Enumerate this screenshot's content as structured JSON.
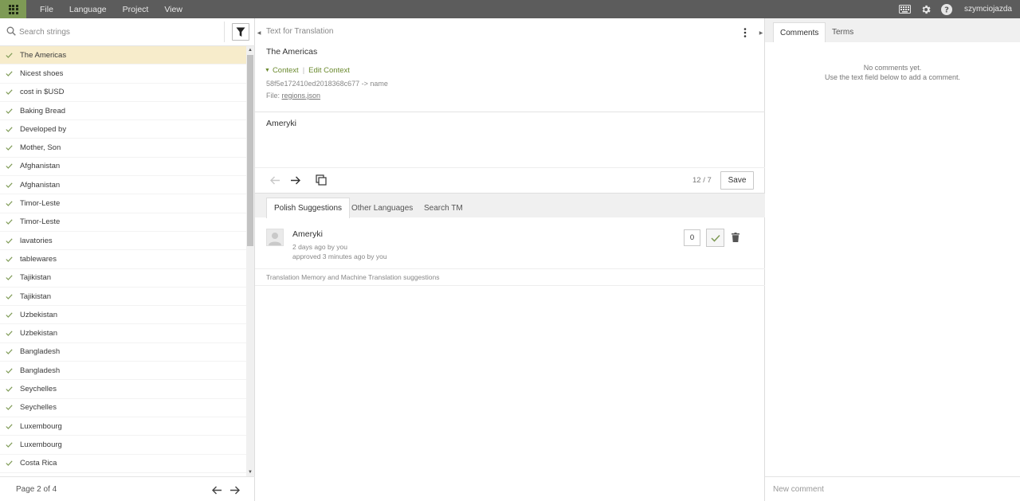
{
  "topbar": {
    "menu": [
      "File",
      "Language",
      "Project",
      "View"
    ],
    "username": "szymciojazda",
    "icons": [
      "apps-icon",
      "keyboard-icon",
      "gear-icon",
      "help-icon"
    ]
  },
  "sidebar": {
    "search_placeholder": "Search strings",
    "items": [
      "The Americas",
      "Nicest shoes",
      "cost in $USD",
      "Baking Bread",
      "Developed by",
      "Mother, Son",
      "Afghanistan",
      "Afghanistan",
      "Timor-Leste",
      "Timor-Leste",
      "lavatories",
      "tablewares",
      "Tajikistan",
      "Tajikistan",
      "Uzbekistan",
      "Uzbekistan",
      "Bangladesh",
      "Bangladesh",
      "Seychelles",
      "Seychelles",
      "Luxembourg",
      "Luxembourg",
      "Costa Rica"
    ],
    "selected_index": 0,
    "page_label": "Page 2 of 4"
  },
  "editor": {
    "source_header": "Text for Translation",
    "source_text": "The Americas",
    "context_label": "Context",
    "edit_context_label": "Edit Context",
    "key": "58f5e172410ed2018368c677 -> name",
    "file_prefix": "File:",
    "file_name": "regions.json",
    "translation": "Ameryki",
    "counter": "12 / 7",
    "save_label": "Save"
  },
  "suggestions": {
    "tabs": [
      "Polish Suggestions",
      "Other Languages",
      "Search TM"
    ],
    "active_tab": 0,
    "items": [
      {
        "text": "Ameryki",
        "meta1": "2 days ago by you",
        "meta2": "approved 3 minutes ago by you",
        "votes": "0"
      }
    ],
    "tm_label": "Translation Memory and Machine Translation suggestions"
  },
  "comments": {
    "tabs": [
      "Comments",
      "Terms"
    ],
    "active_tab": 0,
    "empty_line1": "No comments yet.",
    "empty_line2": "Use the text field below to add a comment.",
    "input_placeholder": "New comment"
  },
  "colors": {
    "topbar": "#5c5c5c",
    "accent_green": "#7e9a55",
    "selected_row": "#f7eccb",
    "link_green": "#6b8a2f"
  }
}
